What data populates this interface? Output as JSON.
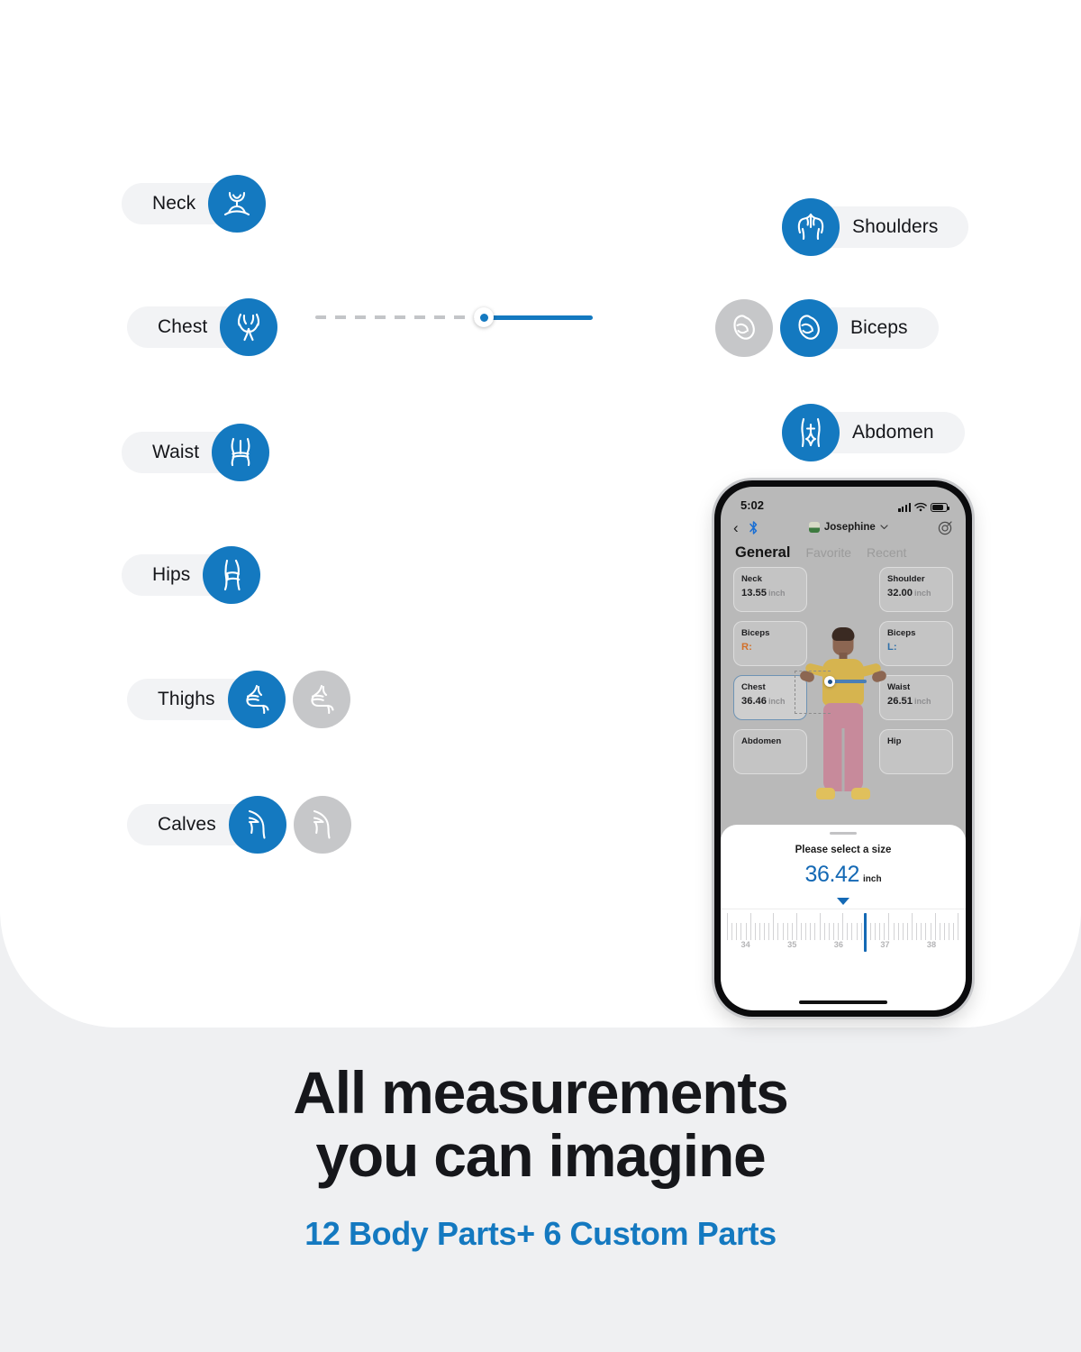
{
  "theme": {
    "accent": "#1479c0",
    "accent_text": "#1479c0",
    "pill_bg": "#f2f3f5",
    "inactive_icon_bg": "#c6c7c9",
    "page_bg": "#eff0f2",
    "card_bg": "#ffffff"
  },
  "left_parts": [
    {
      "label": "Neck",
      "icon": "neck-icon",
      "has_secondary": false
    },
    {
      "label": "Chest",
      "icon": "chest-icon",
      "has_secondary": false
    },
    {
      "label": "Waist",
      "icon": "waist-icon",
      "has_secondary": false
    },
    {
      "label": "Hips",
      "icon": "hips-icon",
      "has_secondary": false
    },
    {
      "label": "Thighs",
      "icon": "thigh-icon",
      "has_secondary": true
    },
    {
      "label": "Calves",
      "icon": "calf-icon",
      "has_secondary": true
    }
  ],
  "right_parts": [
    {
      "label": "Shoulders",
      "icon": "shoulders-icon",
      "has_secondary": false
    },
    {
      "label": "Biceps",
      "icon": "biceps-icon",
      "has_secondary": true
    },
    {
      "label": "Abdomen",
      "icon": "abdomen-icon",
      "has_secondary": false
    }
  ],
  "chest_slider": {
    "dashed_portion_label": "unmeasured",
    "filled_portion_label": "measured",
    "handle_position_percent": 60
  },
  "phone": {
    "status_bar": {
      "time": "5:02",
      "cellular": "signal-bars-icon",
      "wifi": "wifi-icon",
      "battery": "battery-icon"
    },
    "nav": {
      "back": "‹",
      "bluetooth_icon": "bluetooth-icon",
      "profile_name": "Josephine",
      "profile_avatar": "avatar",
      "chevron": "chevron-down-icon",
      "target_icon": "target-icon"
    },
    "tabs": [
      {
        "label": "General",
        "active": true
      },
      {
        "label": "Favorite",
        "active": false
      },
      {
        "label": "Recent",
        "active": false
      }
    ],
    "cards_left": [
      {
        "title": "Neck",
        "value": "13.55",
        "unit": "inch",
        "selected": false,
        "side": ""
      },
      {
        "title": "Biceps",
        "value": "R:",
        "unit": "",
        "selected": false,
        "side": "r"
      },
      {
        "title": "Chest",
        "value": "36.46",
        "unit": "inch",
        "selected": true,
        "side": ""
      },
      {
        "title": "Abdomen",
        "value": "",
        "unit": "",
        "selected": false,
        "side": ""
      }
    ],
    "cards_right": [
      {
        "title": "Shoulder",
        "value": "32.00",
        "unit": "inch",
        "selected": false,
        "side": ""
      },
      {
        "title": "Biceps",
        "value": "L:",
        "unit": "",
        "selected": false,
        "side": "l"
      },
      {
        "title": "Waist",
        "value": "26.51",
        "unit": "inch",
        "selected": false,
        "side": ""
      },
      {
        "title": "Hip",
        "value": "",
        "unit": "",
        "selected": false,
        "side": ""
      }
    ],
    "sheet": {
      "title": "Please select a size",
      "value": "36.42",
      "unit": "inch",
      "ruler_labels": [
        "34",
        "35",
        "36",
        "37",
        "38"
      ],
      "ruler_min": 33.6,
      "ruler_max": 38.6,
      "cursor_value": 36.42
    }
  },
  "footer": {
    "headline_line1": "All measurements",
    "headline_line2": "you can imagine",
    "subheadline": "12 Body Parts+ 6 Custom Parts"
  }
}
